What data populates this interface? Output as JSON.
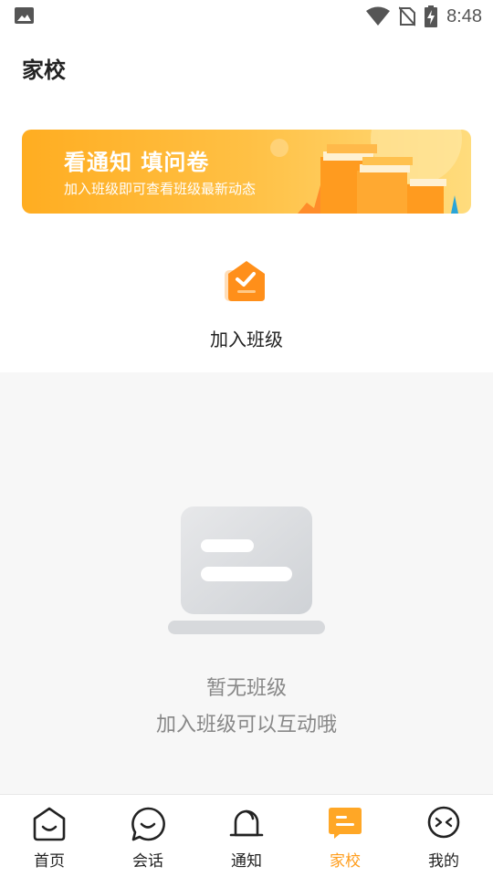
{
  "status_bar": {
    "time": "8:48"
  },
  "header": {
    "title": "家校"
  },
  "banner": {
    "title": "看通知 填问卷",
    "subtitle": "加入班级即可查看班级最新动态"
  },
  "join_class": {
    "label": "加入班级"
  },
  "empty_state": {
    "line1": "暂无班级",
    "line2": "加入班级可以互动哦"
  },
  "bottom_nav": {
    "items": [
      {
        "label": "首页",
        "icon": "home-icon",
        "active": false
      },
      {
        "label": "会话",
        "icon": "chat-icon",
        "active": false
      },
      {
        "label": "通知",
        "icon": "bell-icon",
        "active": false
      },
      {
        "label": "家校",
        "icon": "school-icon",
        "active": true
      },
      {
        "label": "我的",
        "icon": "profile-icon",
        "active": false
      }
    ]
  },
  "colors": {
    "accent": "#ff9d1c",
    "banner_start": "#ffad21",
    "banner_end": "#ffdc7d"
  }
}
